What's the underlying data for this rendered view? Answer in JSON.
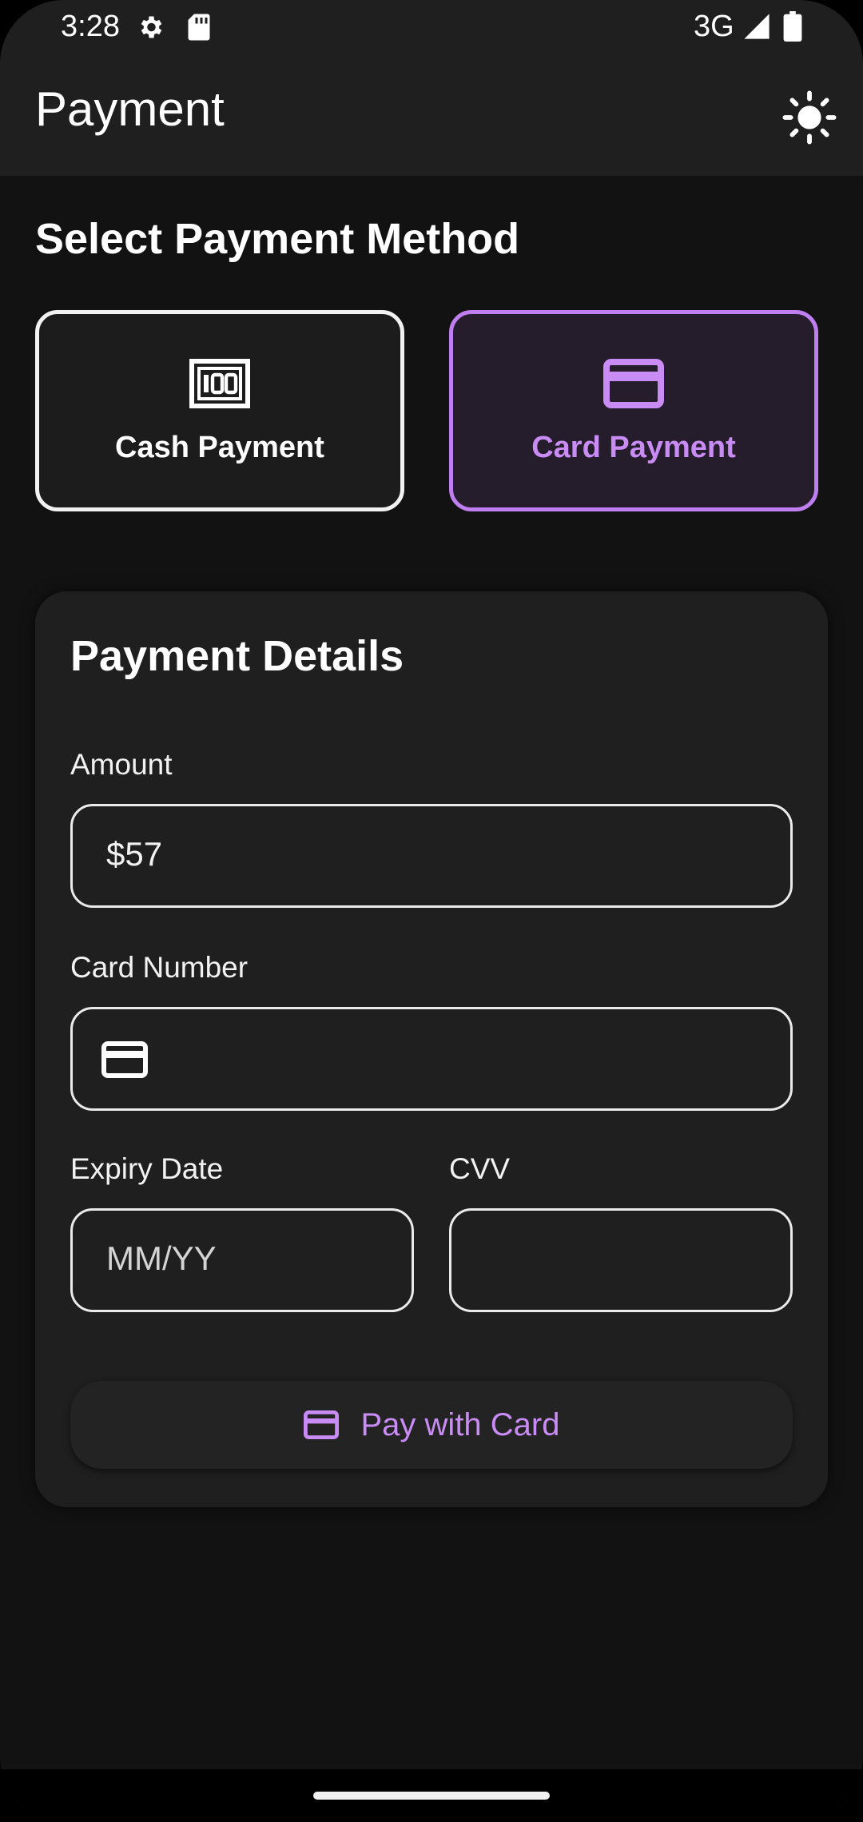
{
  "status_bar": {
    "time": "3:28",
    "network": "3G",
    "icons": [
      "settings-gear-icon",
      "sd-card-icon",
      "cell-signal-icon",
      "battery-icon"
    ]
  },
  "app_bar": {
    "title": "Payment",
    "theme_toggle_icon": "sun-icon"
  },
  "payment_method": {
    "heading": "Select Payment Method",
    "options": [
      {
        "label": "Cash Payment",
        "icon": "cash-icon",
        "selected": false
      },
      {
        "label": "Card Payment",
        "icon": "credit-card-icon",
        "selected": true
      }
    ]
  },
  "details": {
    "heading": "Payment Details",
    "amount": {
      "label": "Amount",
      "value": "$57"
    },
    "card_number": {
      "label": "Card Number",
      "value": "",
      "icon": "credit-card-icon"
    },
    "expiry": {
      "label": "Expiry Date",
      "placeholder": "MM/YY",
      "value": ""
    },
    "cvv": {
      "label": "CVV",
      "value": ""
    },
    "submit": {
      "label": "Pay with Card",
      "icon": "credit-card-icon"
    }
  },
  "colors": {
    "background": "#121212",
    "surface": "#1f1f1f",
    "accent": "#c98cf5",
    "selected_border": "#c07ff0",
    "text": "#ffffff"
  }
}
